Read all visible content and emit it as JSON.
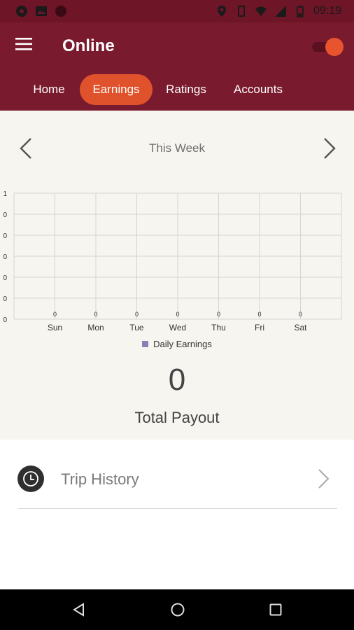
{
  "status_bar": {
    "time": "09:19",
    "left_icons": [
      "sync-icon",
      "image-icon",
      "circle-icon"
    ],
    "right_icons": [
      "location-icon",
      "vibrate-icon",
      "wifi-icon",
      "signal-icon",
      "battery-icon"
    ]
  },
  "header": {
    "title": "Online",
    "menu_icon": "hamburger-menu-icon",
    "online_toggle": true
  },
  "tabs": [
    {
      "label": "Home",
      "active": false
    },
    {
      "label": "Earnings",
      "active": true
    },
    {
      "label": "Ratings",
      "active": false
    },
    {
      "label": "Accounts",
      "active": false
    }
  ],
  "period": {
    "label": "This Week",
    "prev_icon": "chevron-left-icon",
    "next_icon": "chevron-right-icon"
  },
  "chart_data": {
    "type": "bar",
    "categories": [
      "Sun",
      "Mon",
      "Tue",
      "Wed",
      "Thu",
      "Fri",
      "Sat"
    ],
    "series": [
      {
        "name": "Daily Earnings",
        "values": [
          0,
          0,
          0,
          0,
          0,
          0,
          0
        ]
      }
    ],
    "y_tick_labels": [
      "1",
      "0",
      "0",
      "0",
      "0",
      "0",
      "0"
    ],
    "ylim": [
      0,
      1
    ],
    "grid": true,
    "legend_position": "bottom",
    "series_color": "#8b7fb8"
  },
  "payout": {
    "value": "0",
    "label": "Total Payout"
  },
  "trip_history": {
    "label": "Trip History",
    "icon": "clock-icon",
    "chevron_icon": "chevron-right-icon"
  },
  "system_nav": {
    "back_icon": "back-triangle-icon",
    "home_icon": "home-circle-icon",
    "recents_icon": "recents-square-icon"
  },
  "colors": {
    "header": "#7a1a2e",
    "accent": "#e0522c",
    "content_bg": "#f6f5f0"
  }
}
